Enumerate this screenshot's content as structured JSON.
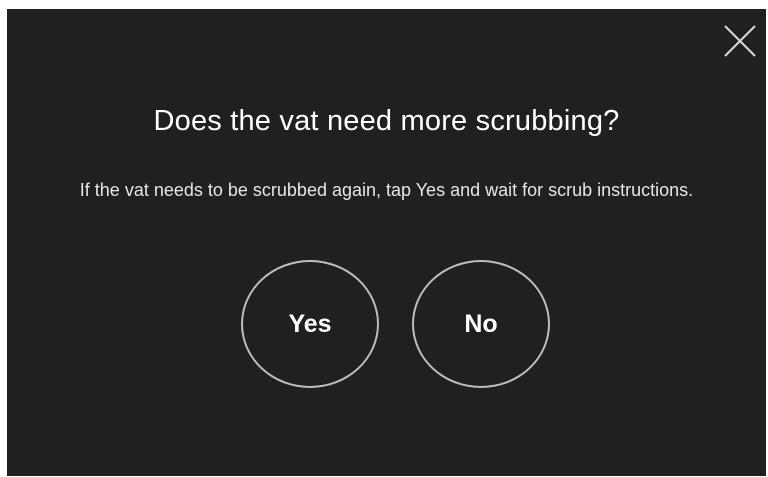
{
  "dialog": {
    "title": "Does the vat need more scrubbing?",
    "message": "If the vat needs to be scrubbed again, tap Yes and wait for scrub instructions.",
    "yes_label": "Yes",
    "no_label": "No",
    "close_icon": "close-icon"
  },
  "colors": {
    "background": "#202023",
    "text": "#ffffff",
    "button_border": "#bdbdbd"
  }
}
